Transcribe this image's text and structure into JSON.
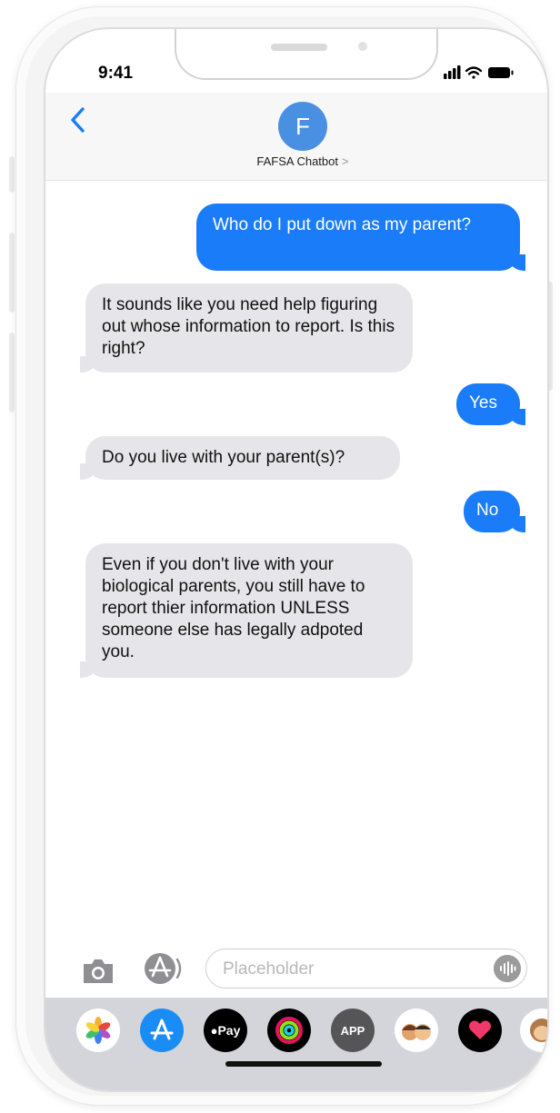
{
  "status_bar": {
    "time": "9:41"
  },
  "header": {
    "avatar_initial": "F",
    "contact_name": "FAFSA Chatbot",
    "contact_chevron": ">"
  },
  "messages": [
    {
      "sender": "user",
      "text": "Who do I put down as my parent?"
    },
    {
      "sender": "bot",
      "text": "It sounds like you need help figuring out whose information to report. Is this right?"
    },
    {
      "sender": "user",
      "text": "Yes"
    },
    {
      "sender": "bot",
      "text": "Do you live with your parent(s)?"
    },
    {
      "sender": "user",
      "text": "No"
    },
    {
      "sender": "bot",
      "text": "Even if you don't live with your biological parents, you still have to report thier information UNLESS someone else has legally adpoted you."
    }
  ],
  "composer": {
    "placeholder": "Placeholder"
  },
  "app_drawer": {
    "apple_pay_label": "Pay",
    "app_label": "APP"
  },
  "colors": {
    "outgoing_bubble": "#1a7cf8",
    "incoming_bubble": "#e6e6ea",
    "avatar": "#4a90e2",
    "accent": "#1a7cf8"
  }
}
